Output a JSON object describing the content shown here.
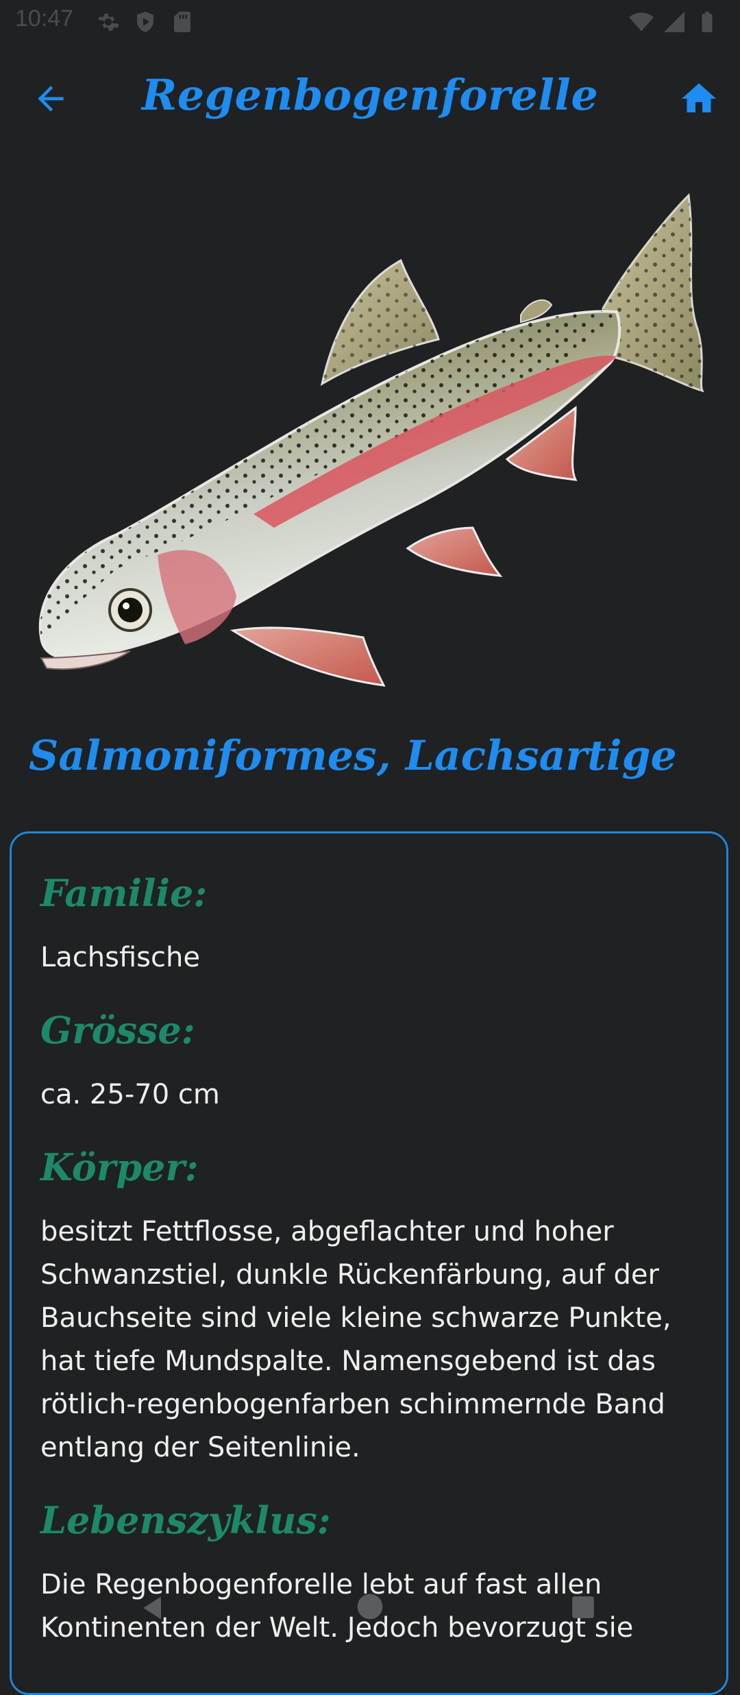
{
  "status_bar": {
    "time": "10:47",
    "icons": [
      "settings-icon",
      "shield-play-icon",
      "sd-card-icon",
      "wifi-icon",
      "signal-icon",
      "battery-icon"
    ]
  },
  "app_bar": {
    "title": "Regenbogenforelle",
    "back_icon": "arrow-left-icon",
    "home_icon": "home-icon",
    "accent": "#1e8cf0"
  },
  "order": "Salmoniformes, Lachsartige",
  "sections": [
    {
      "heading": "Familie:",
      "text": "Lachsfische"
    },
    {
      "heading": "Grösse:",
      "text": "ca. 25-70 cm"
    },
    {
      "heading": "Körper:",
      "text": "besitzt Fettflosse, abgeflachter und hoher Schwanzstiel, dunkle Rückenfärbung, auf der Bauchseite sind viele kleine schwarze Punkte, hat tiefe Mundspalte. Namensgebend ist das rötlich-regenbogenfarben schimmernde Band entlang der Seitenlinie."
    },
    {
      "heading": "Lebenszyklus:",
      "text": "Die Regenbogenforelle lebt auf fast allen Kontinenten der Welt. Jedoch bevorzugt sie"
    }
  ],
  "colors": {
    "background": "#1f2123",
    "heading_green": "#1c8a6a",
    "card_border": "#1f86d8"
  },
  "nav_bar": {
    "icons": [
      "nav-back-icon",
      "nav-home-icon",
      "nav-recents-icon"
    ]
  }
}
